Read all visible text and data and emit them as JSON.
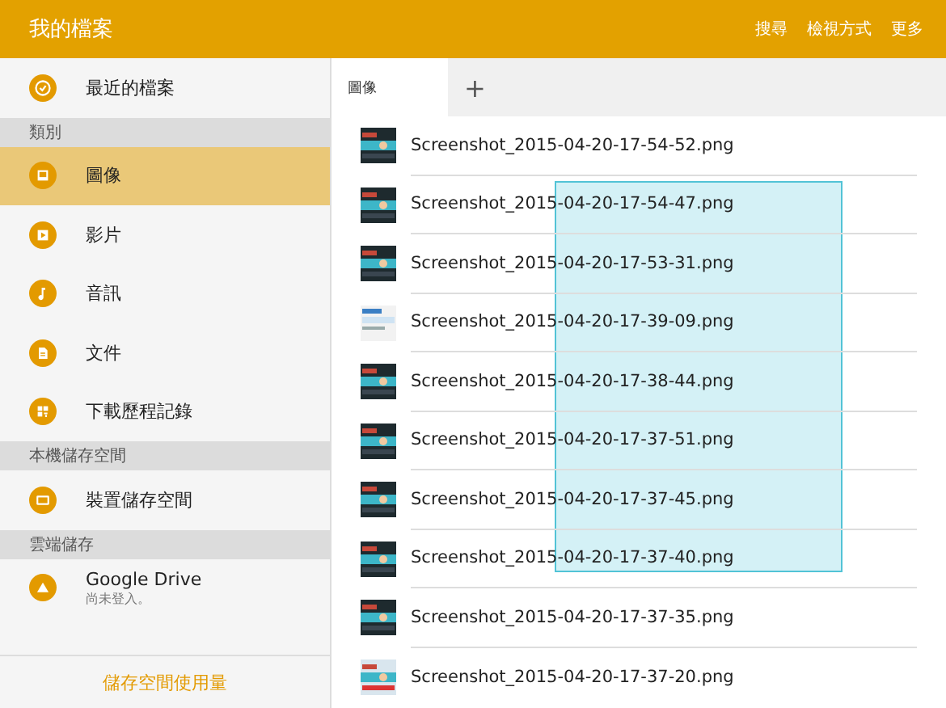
{
  "app_bar": {
    "title": "我的檔案",
    "actions": [
      "搜尋",
      "檢視方式",
      "更多"
    ]
  },
  "sidebar": {
    "sections": [
      {
        "items": [
          {
            "label": "最近的檔案",
            "selected": false
          }
        ]
      },
      {
        "header": "類別",
        "items": [
          {
            "label": "圖像",
            "selected": true
          },
          {
            "label": "影片",
            "selected": false
          },
          {
            "label": "音訊",
            "selected": false
          },
          {
            "label": "文件",
            "selected": false
          },
          {
            "label": "下載歷程記錄",
            "selected": false
          }
        ]
      },
      {
        "header": "本機儲存空間",
        "items": [
          {
            "label": "裝置儲存空間",
            "selected": false
          }
        ]
      },
      {
        "header": "雲端儲存",
        "items": [
          {
            "label": "Google Drive",
            "subtitle": "尚未登入。",
            "selected": false
          }
        ]
      }
    ],
    "footer": "儲存空間使用量"
  },
  "tabs": [
    {
      "label": "圖像",
      "selected": true
    },
    {
      "label": "+",
      "selected": false
    }
  ],
  "files": [
    {
      "name": "Screenshot_2015-04-20-17-54-52.png"
    },
    {
      "name": "Screenshot_2015-04-20-17-54-47.png"
    },
    {
      "name": "Screenshot_2015-04-20-17-53-31.png"
    },
    {
      "name": "Screenshot_2015-04-20-17-39-09.png"
    },
    {
      "name": "Screenshot_2015-04-20-17-38-44.png"
    },
    {
      "name": "Screenshot_2015-04-20-17-37-51.png"
    },
    {
      "name": "Screenshot_2015-04-20-17-37-45.png"
    },
    {
      "name": "Screenshot_2015-04-20-17-37-40.png"
    },
    {
      "name": "Screenshot_2015-04-20-17-37-35.png"
    },
    {
      "name": "Screenshot_2015-04-20-17-37-20.png"
    }
  ],
  "drag_selection": true
}
